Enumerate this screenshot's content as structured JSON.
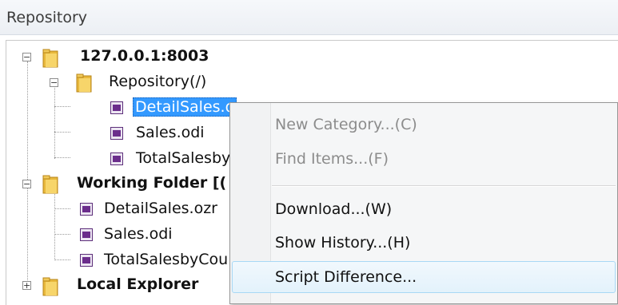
{
  "panel": {
    "title": "Repository"
  },
  "tree": {
    "server": {
      "label": "127.0.0.1:8003",
      "expander": "−"
    },
    "repository": {
      "label": "Repository(/)",
      "expander": "−"
    },
    "repo_files": [
      "DetailSales.o",
      "Sales.odi",
      "TotalSalesby"
    ],
    "working_folder": {
      "label": "Working Folder [(",
      "expander": "−"
    },
    "working_files": [
      "DetailSales.ozr",
      "Sales.odi",
      "TotalSalesbyCou"
    ],
    "local_explorer": {
      "label": "Local Explorer",
      "expander": "+"
    }
  },
  "context_menu": {
    "new_category": "New Category...(C)",
    "find_items": "Find Items...(F)",
    "download": "Download...(W)",
    "show_history": "Show History...(H)",
    "script_difference": "Script Difference..."
  },
  "colors": {
    "selection": "#3399ff",
    "disabled_text": "#8c8c8c",
    "menu_hover_border": "#a8d8f5"
  }
}
